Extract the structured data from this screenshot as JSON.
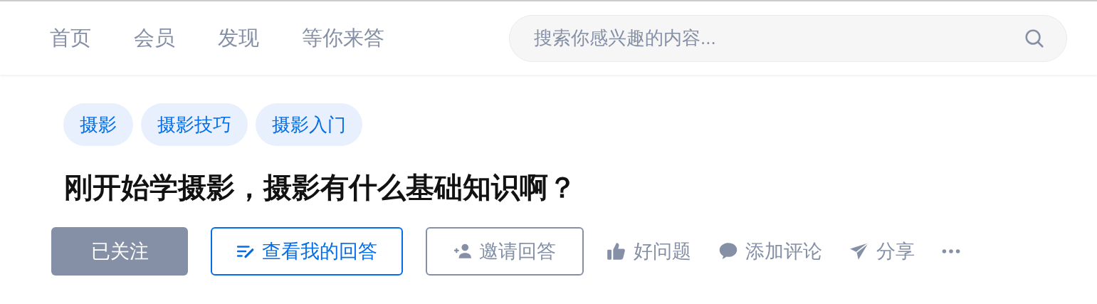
{
  "nav": [
    {
      "label": "首页"
    },
    {
      "label": "会员"
    },
    {
      "label": "发现"
    },
    {
      "label": "等你来答"
    }
  ],
  "search": {
    "placeholder": "搜索你感兴趣的内容..."
  },
  "tags": [
    "摄影",
    "摄影技巧",
    "摄影入门"
  ],
  "question": {
    "title": "刚开始学摄影，摄影有什么基础知识啊？"
  },
  "follow_button": {
    "label": "已关注",
    "followed": true
  },
  "buttons": [
    {
      "kind": "answer",
      "label": "查看我的回答"
    },
    {
      "kind": "invite",
      "label": "邀请回答"
    }
  ],
  "actions": [
    {
      "kind": "like",
      "label": "好问题"
    },
    {
      "kind": "comment",
      "label": "添加评论"
    },
    {
      "kind": "share",
      "label": "分享"
    },
    {
      "kind": "more"
    }
  ]
}
